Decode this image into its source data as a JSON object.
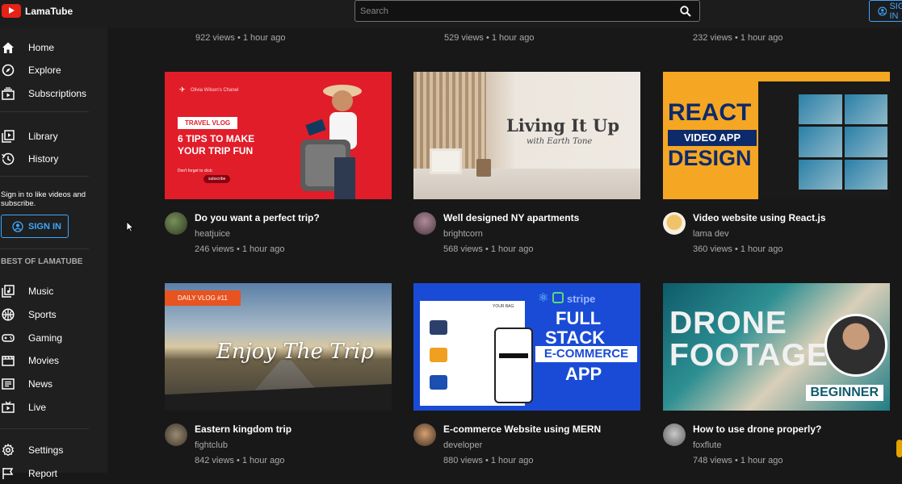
{
  "header": {
    "app_name": "LamaTube",
    "search_placeholder": "Search",
    "signin_label": "SIGN IN"
  },
  "sidebar": {
    "items": [
      {
        "label": "Home",
        "icon": "home-icon"
      },
      {
        "label": "Explore",
        "icon": "compass-icon"
      },
      {
        "label": "Subscriptions",
        "icon": "subscriptions-icon"
      },
      {
        "label": "Library",
        "icon": "library-icon"
      },
      {
        "label": "History",
        "icon": "history-icon"
      }
    ],
    "signin_text": "Sign in to like videos and subscribe.",
    "signin_button": "SIGN IN",
    "best_title": "BEST OF LAMATUBE",
    "best_items": [
      {
        "label": "Music",
        "icon": "music-icon"
      },
      {
        "label": "Sports",
        "icon": "sports-icon"
      },
      {
        "label": "Gaming",
        "icon": "gaming-icon"
      },
      {
        "label": "Movies",
        "icon": "movies-icon"
      },
      {
        "label": "News",
        "icon": "news-icon"
      },
      {
        "label": "Live",
        "icon": "live-icon"
      }
    ],
    "settings": {
      "label": "Settings",
      "icon": "gear-icon"
    },
    "report": {
      "label": "Report",
      "icon": "flag-icon"
    }
  },
  "top_row_meta": [
    "922 views • 1 hour ago",
    "529 views • 1 hour ago",
    "232 views • 1 hour ago"
  ],
  "videos": [
    {
      "title": "Do you want a perfect trip?",
      "channel": "heatjuice",
      "views": "246 views • 1 hour ago",
      "thumb": {
        "channel_tag": "Olivia Wilson's Chanel",
        "badge": "TRAVEL VLOG",
        "headline_1": "6 TIPS TO MAKE",
        "headline_2": "YOUR TRIP FUN",
        "small": "Don't forget to click:",
        "subscribe": "subscribe"
      }
    },
    {
      "title": "Well designed NY apartments",
      "channel": "brightcorn",
      "views": "568 views • 1 hour ago",
      "thumb": {
        "headline": "Living It Up",
        "sub": "with Earth Tone"
      }
    },
    {
      "title": "Video website using React.js",
      "channel": "lama dev",
      "views": "360 views • 1 hour ago",
      "thumb": {
        "line1": "REACT",
        "line2": "VIDEO APP",
        "line3": "DESIGN"
      }
    },
    {
      "title": "Eastern kingdom trip",
      "channel": "fightclub",
      "views": "842 views • 1 hour ago",
      "thumb": {
        "badge": "DAILY VLOG #11",
        "headline": "Enjoy The Trip"
      }
    },
    {
      "title": "E-commerce Website using MERN",
      "channel": "developer",
      "views": "880 views • 1 hour ago",
      "thumb": {
        "bag": "YOUR BAG",
        "stripe": "stripe",
        "line1": "FULL",
        "line2": "STACK",
        "line3": "E-COMMERCE",
        "line4": "APP"
      }
    },
    {
      "title": "How to use drone properly?",
      "channel": "foxflute",
      "views": "748 views • 1 hour ago",
      "thumb": {
        "line1": "DRONE",
        "line2": "FOOTAGE",
        "badge": "BEGINNER"
      }
    }
  ],
  "colors": {
    "background": "#181818",
    "sidebar": "#1f1f1f",
    "accent": "#3ea6ff",
    "brand_red": "#e62117"
  }
}
